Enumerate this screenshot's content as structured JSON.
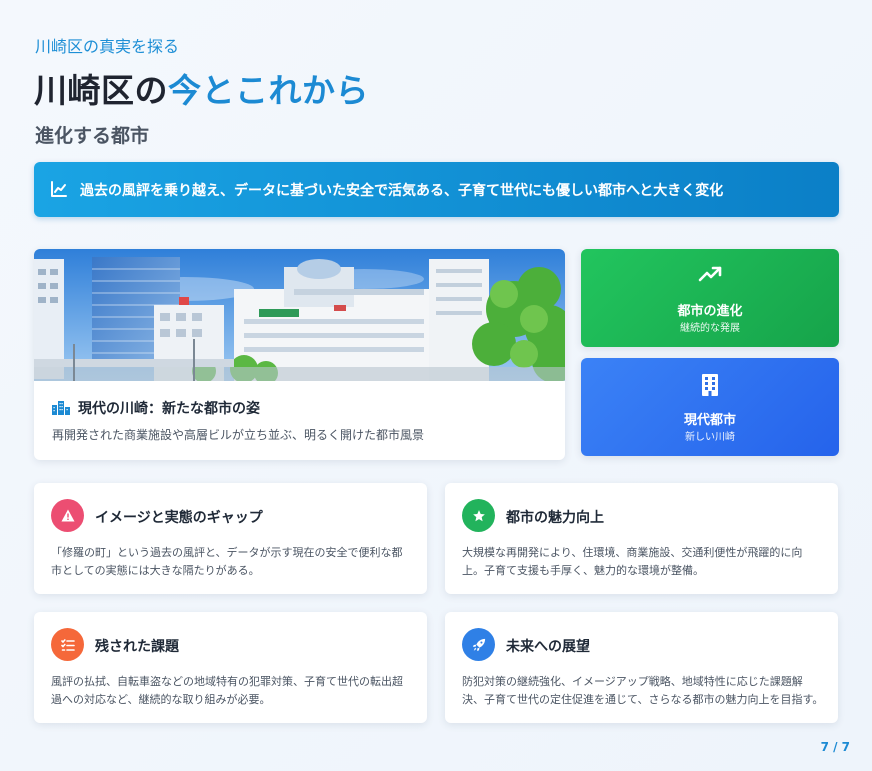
{
  "header": {
    "kicker": "川崎区の真実を探る",
    "title_main": "川崎区の",
    "title_accent": "今とこれから",
    "subtitle": "進化する都市"
  },
  "banner": {
    "icon": "line-chart-icon",
    "text": "過去の風評を乗り越え、データに基づいた安全で活気ある、子育て世代にも優しい都市へと大きく変化"
  },
  "photo_card": {
    "icon": "city-buildings-icon",
    "title": "現代の川崎：新たな都市の姿",
    "description": "再開発された商業施設や高層ビルが立ち並ぶ、明るく開けた都市風景"
  },
  "stats": [
    {
      "icon": "trending-up-icon",
      "label": "都市の進化",
      "sub": "継続的な発展",
      "color": "#22c55e"
    },
    {
      "icon": "building-icon",
      "label": "現代都市",
      "sub": "新しい川崎",
      "color": "#3b82f6"
    }
  ],
  "cards": [
    {
      "icon": "warning-icon",
      "color": "#ec4e72",
      "title": "イメージと実態のギャップ",
      "body": "「修羅の町」という過去の風評と、データが示す現在の安全で便利な都市としての実態には大きな隔たりがある。"
    },
    {
      "icon": "star-icon",
      "color": "#22b35c",
      "title": "都市の魅力向上",
      "body": "大規模な再開発により、住環境、商業施設、交通利便性が飛躍的に向上。子育て支援も手厚く、魅力的な環境が整備。"
    },
    {
      "icon": "task-list-icon",
      "color": "#f5683a",
      "title": "残された課題",
      "body": "風評の払拭、自転車盗などの地域特有の犯罪対策、子育て世代の転出超過への対応など、継続的な取り組みが必要。"
    },
    {
      "icon": "rocket-icon",
      "color": "#2f80e6",
      "title": "未来への展望",
      "body": "防犯対策の継続強化、イメージアップ戦略、地域特性に応じた課題解決、子育て世代の定住促進を通じて、さらなる都市の魅力向上を目指す。"
    }
  ],
  "pager": "7 / 7"
}
